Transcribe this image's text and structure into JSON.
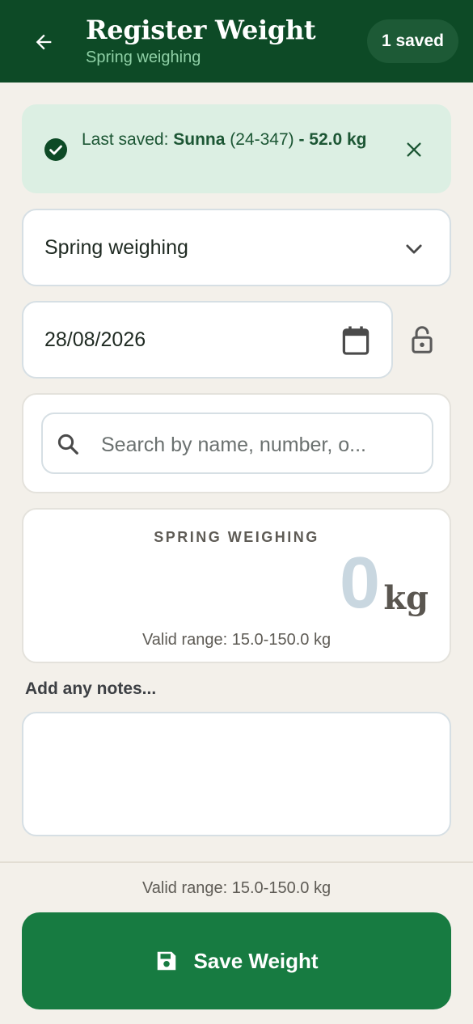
{
  "header": {
    "title": "Register Weight",
    "subtitle": "Spring weighing",
    "saved_badge": "1 saved",
    "back_icon": "arrow-left-icon"
  },
  "banner": {
    "prefix": "Last saved: ",
    "animal_name": "Sunna",
    "animal_number": " (24-347) ",
    "weight": "- 52.0 kg",
    "icon": "check-circle-icon",
    "close_icon": "close-icon"
  },
  "form": {
    "session_select": "Spring weighing",
    "date_value": "28/08/2026",
    "search_placeholder": "Search by name, number, o..."
  },
  "weight_display": {
    "label": "SPRING WEIGHING",
    "value": "0",
    "unit": "kg",
    "range": "Valid range: 15.0-150.0 kg"
  },
  "notes": {
    "label": "Add any notes..."
  },
  "footer": {
    "range": "Valid range: 15.0-150.0 kg",
    "save_label": "Save Weight"
  },
  "colors": {
    "header_bg": "#0d4a26",
    "banner_bg": "#dcefe3",
    "primary": "#177b41",
    "background": "#f3f0ea"
  }
}
